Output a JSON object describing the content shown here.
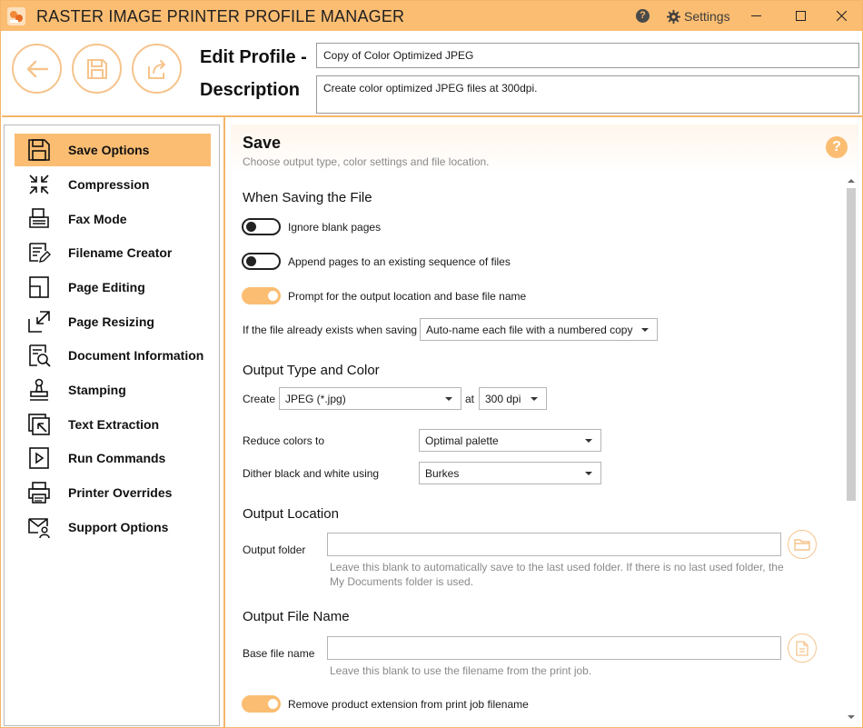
{
  "window": {
    "title": "RASTER IMAGE PRINTER PROFILE MANAGER",
    "settings_label": "Settings",
    "help_glyph": "?"
  },
  "header": {
    "edit_profile_label": "Edit Profile -",
    "description_label": "Description",
    "profile_name": "Copy of Color Optimized JPEG",
    "description": "Create color optimized JPEG files at 300dpi."
  },
  "sidebar": {
    "items": [
      {
        "label": "Save Options",
        "icon": "save-icon",
        "active": true
      },
      {
        "label": "Compression",
        "icon": "compress-icon"
      },
      {
        "label": "Fax Mode",
        "icon": "fax-icon"
      },
      {
        "label": "Filename Creator",
        "icon": "filename-icon"
      },
      {
        "label": "Page Editing",
        "icon": "page-edit-icon"
      },
      {
        "label": "Page Resizing",
        "icon": "resize-icon"
      },
      {
        "label": "Document Information",
        "icon": "doc-info-icon"
      },
      {
        "label": "Stamping",
        "icon": "stamp-icon"
      },
      {
        "label": "Text Extraction",
        "icon": "text-extract-icon"
      },
      {
        "label": "Run Commands",
        "icon": "run-icon"
      },
      {
        "label": "Printer Overrides",
        "icon": "printer-icon"
      },
      {
        "label": "Support Options",
        "icon": "support-icon"
      }
    ]
  },
  "main": {
    "title": "Save",
    "subtitle": "Choose output type, color settings and file location.",
    "help_glyph": "?",
    "saving": {
      "heading": "When Saving the File",
      "ignore_blank": "Ignore blank pages",
      "append_pages": "Append pages to an existing sequence of files",
      "prompt_location": "Prompt for the output location and base file name",
      "exists_label": "If the file already exists when saving",
      "exists_value": "Auto-name each file with a numbered copy"
    },
    "output_type": {
      "heading": "Output Type and Color",
      "create_label": "Create",
      "create_value": "JPEG (*.jpg)",
      "at_label": "at",
      "dpi_value": "300 dpi",
      "reduce_label": "Reduce colors to",
      "reduce_value": "Optimal palette",
      "dither_label": "Dither black and white using",
      "dither_value": "Burkes"
    },
    "location": {
      "heading": "Output Location",
      "folder_label": "Output folder",
      "folder_value": "",
      "hint_line1": "Leave this blank to automatically save to the last used folder. If there is no last used folder, the",
      "hint_line2": "My Documents folder is used."
    },
    "filename": {
      "heading": "Output File Name",
      "base_label": "Base file name",
      "base_value": "",
      "hint": "Leave this blank to use the filename from the print job.",
      "remove_ext": "Remove product extension from print job filename"
    }
  },
  "colors": {
    "accent": "#fbbd72",
    "border": "#f5b56a"
  }
}
